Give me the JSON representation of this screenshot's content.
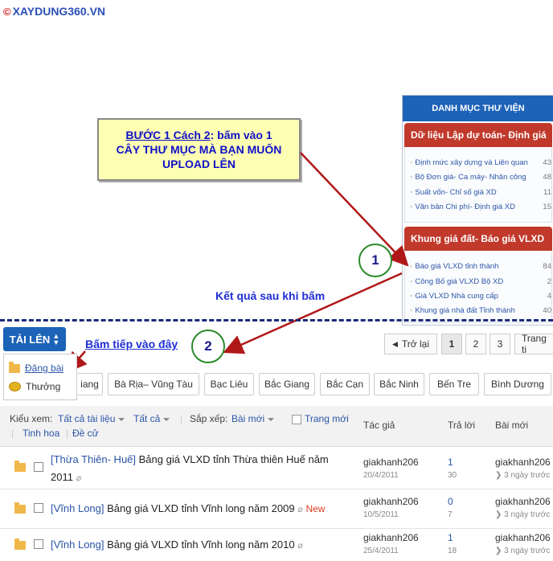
{
  "logo": {
    "symbol": "©",
    "text": "XAYDUNG360.VN"
  },
  "side_panel": {
    "title": "DANH MỤC THƯ VIỆN",
    "categories": [
      {
        "title": "Dữ liệu Lập dự toán- Định giá",
        "items": [
          {
            "label": "Định mức xây dựng và Liên quan",
            "count": "43"
          },
          {
            "label": "Bộ Đơn giá- Ca máy- Nhân công",
            "count": "48"
          },
          {
            "label": "Suất vốn- Chỉ số giá XD",
            "count": "11"
          },
          {
            "label": "Văn bản Chi phí- Định giá XD",
            "count": "15"
          }
        ]
      },
      {
        "title": "Khung giá đất- Báo giá VLXD",
        "items": [
          {
            "label": "Báo giá VLXD tỉnh thành",
            "count": "84"
          },
          {
            "label": "Công Bố giá VLXD Bộ XD",
            "count": "2"
          },
          {
            "label": "Giá VLXD Nhà cung cấp",
            "count": "4"
          },
          {
            "label": "Khung giá nhà đất Tỉnh thành",
            "count": "40"
          }
        ]
      }
    ]
  },
  "annotation": {
    "step_title": "BƯỚC 1  Cách 2",
    "step_text_1": ": bấm vào 1",
    "step_text_2": "CÂY THƯ MỤC MÀ BẠN MUỐN",
    "step_text_3": "UPLOAD LÊN",
    "marker1": "1",
    "marker2": "2",
    "result_text": "Kết quả sau khi bấm",
    "next_text": "Bấm tiếp vào đây"
  },
  "toolbar": {
    "upload_label": "TẢI LÊN"
  },
  "upload_menu": [
    {
      "label": "Đăng bài"
    },
    {
      "label": "Thưởng"
    }
  ],
  "pager": {
    "prev": "Trở lại",
    "pages": [
      "1",
      "2",
      "3"
    ],
    "next": "Trang ti"
  },
  "tags": [
    "iang",
    "Bà Rịa– Vũng Tàu",
    "Bạc Liêu",
    "Bắc Giang",
    "Bắc Cạn",
    "Bắc Ninh",
    "Bến Tre",
    "Bình Dương"
  ],
  "filters": {
    "view_label": "Kiểu xem:",
    "view_value": "Tất cả tài liệu",
    "all_value": "Tất cả",
    "sort_label": "Sắp xếp:",
    "sort_value": "Bài mới",
    "featured": "Trang mới",
    "best": "Tinh hoa",
    "sticky": "Đề cử",
    "col_author": "Tác giả",
    "col_reply": "Trả lời",
    "col_last": "Bài mới"
  },
  "rows": [
    {
      "prefix": "[Thừa Thiên- Huế]",
      "title": "Bảng giá VLXD tỉnh Thừa thiên Huế năm",
      "title2": "2011",
      "new": "",
      "author": "giakhanh206",
      "date": "20/4/2011",
      "replies": "1",
      "views": "30",
      "last_user": "giakhanh206",
      "last_time": "3 ngày trước"
    },
    {
      "prefix": "[Vĩnh Long]",
      "title": "Bảng giá VLXD tỉnh Vĩnh long năm 2009",
      "title2": "",
      "new": "New",
      "author": "giakhanh206",
      "date": "10/5/2011",
      "replies": "0",
      "views": "7",
      "last_user": "giakhanh206",
      "last_time": "3 ngày trước"
    },
    {
      "prefix": "[Vĩnh Long]",
      "title": "Bảng giá VLXD tỉnh Vĩnh long năm 2010",
      "title2": "",
      "new": "",
      "author": "giakhanh206",
      "date": "25/4/2011",
      "replies": "1",
      "views": "18",
      "last_user": "giakhanh206",
      "last_time": "3 ngày trước"
    }
  ],
  "colors": {
    "primary": "#1d63b8",
    "category": "#c0392b",
    "annotation": "#1f2fd6",
    "arrow": "#b01818"
  }
}
